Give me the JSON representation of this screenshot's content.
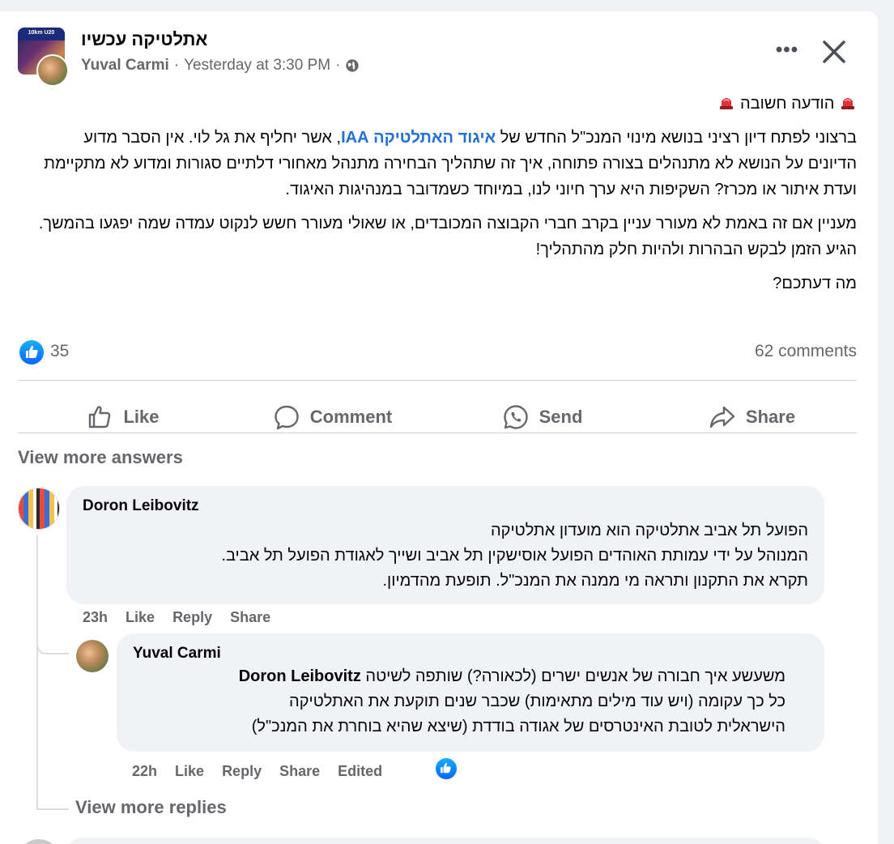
{
  "post": {
    "group_name": "אתלטיקה עכשיו",
    "group_avatar_banner": "10km U20",
    "author": "Yuval Carmi",
    "separator": "·",
    "timestamp": "Yesterday at 3:30 PM",
    "privacy_icon": "globe-icon",
    "more_icon": "more-options-icon",
    "close_icon": "close-icon",
    "title": "הודעה חשובה",
    "title_icon": "siren-icon",
    "paragraph1_before_link": "ברצוני לפתח דיון רציני בנושא מינוי המנכ\"ל החדש של ",
    "paragraph1_link": "איגוד האתלטיקה IAA",
    "paragraph1_after_link": ", אשר יחליף את גל לוי. אין הסבר מדוע הדיונים על הנושא לא מתנהלים בצורה פתוחה, איך זה שתהליך הבחירה מתנהל מאחורי דלתיים סגורות ומדוע לא מתקיימת ועדת איתור או מכרז? השקיפות היא ערך חיוני לנו, במיוחד כשמדובר במנהיגות האיגוד.",
    "paragraph2": "מעניין אם זה באמת לא מעורר עניין בקרב חברי הקבוצה המכובדים, או שאולי מעורר חשש לנקוט עמדה שמה יפגעו בהמשך. הגיע הזמן לבקש הבהרות ולהיות חלק מהתהליך!",
    "paragraph3": "מה דעתכם?"
  },
  "stats": {
    "likes": "35",
    "comments": "62 comments"
  },
  "actions": {
    "like": "Like",
    "comment": "Comment",
    "send": "Send",
    "share": "Share"
  },
  "comments": {
    "view_more_answers": "View more answers",
    "first": {
      "author": "Doron Leibovitz",
      "lines": [
        "הפועל תל אביב אתלטיקה הוא מועדון אתלטיקה",
        "המנוהל על ידי עמותת האוהדים הפועל אוסישקין תל אביב ושייך לאגודת הפועל תל אביב.",
        "תקרא את התקנון ותראה מי ממנה את המנכ\"ל. תופעת מהדמיון."
      ],
      "time": "23h",
      "like": "Like",
      "reply": "Reply",
      "share": "Share"
    },
    "reply": {
      "author": "Yuval Carmi",
      "mention": "Doron Leibovitz",
      "line1_rest": "משעשע איך חבורה של אנשים ישרים (לכאורה?) שותפה לשיטה",
      "line2": "כל כך עקומה (ויש עוד מילים מתאימות) שכבר שנים תוקעת את האתלטיקה",
      "line3": "הישראלית לטובת האינטרסים של אגודה בודדת (שיצא שהיא בוחרת את המנכ\"ל)",
      "time": "22h",
      "like": "Like",
      "reply": "Reply",
      "share": "Share",
      "edited": "Edited"
    },
    "view_more_replies": "View more replies"
  },
  "colors": {
    "link": "#216fdb",
    "secondary_text": "#65676b",
    "bubble": "#f0f2f5",
    "like_blue": "#0866ff"
  }
}
